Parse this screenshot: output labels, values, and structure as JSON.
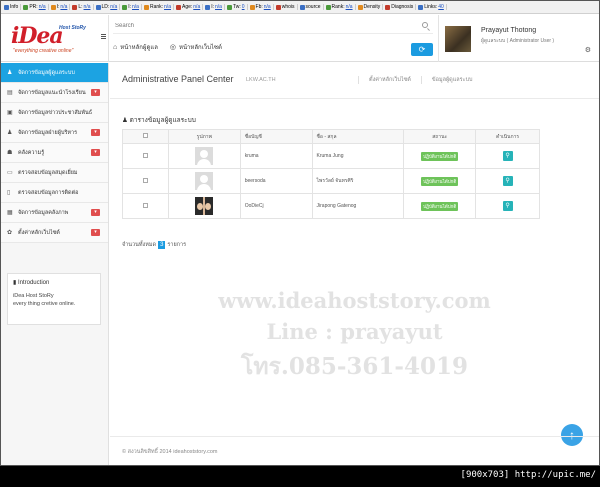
{
  "seo_bar": [
    {
      "label": "Info",
      "value": ""
    },
    {
      "label": "PR:",
      "value": "n/a"
    },
    {
      "label": "I:",
      "value": "n/a"
    },
    {
      "label": "L:",
      "value": "n/a"
    },
    {
      "label": "LD:",
      "value": "n/a"
    },
    {
      "label": "I:",
      "value": "n/a"
    },
    {
      "label": "Rank:",
      "value": "n/a"
    },
    {
      "label": "Age:",
      "value": "n/a"
    },
    {
      "label": "I:",
      "value": "n/a"
    },
    {
      "label": "Tw:",
      "value": "0"
    },
    {
      "label": "Fb:",
      "value": "n/a"
    },
    {
      "label": "whois",
      "value": ""
    },
    {
      "label": "source",
      "value": ""
    },
    {
      "label": "Rank:",
      "value": "n/a"
    },
    {
      "label": "Density",
      "value": ""
    },
    {
      "label": "Diagnosis",
      "value": ""
    },
    {
      "label": "Links:",
      "value": "40"
    }
  ],
  "logo": {
    "text": "iDea",
    "small": "Host StoRy",
    "tagline": "\"everything creative online\""
  },
  "search": {
    "placeholder": "Search"
  },
  "topnav": [
    {
      "label": "หน้าหลักผู้ดูแล",
      "icon": "⌂"
    },
    {
      "label": "หน้าหลักเว็บไซต์",
      "icon": "◎"
    }
  ],
  "user": {
    "name": "Prayayut Thotong",
    "role": "ผู้ดูแลระบบ ( Administrator User )"
  },
  "sidebar": {
    "items": [
      {
        "label": "จัดการข้อมูลผู้ดูแลระบบ",
        "icon": "♟",
        "active": true,
        "caret": false
      },
      {
        "label": "จัดการข้อมูลแนะนำโรงเรียน",
        "icon": "▤",
        "active": false,
        "caret": true
      },
      {
        "label": "จัดการข้อมูลข่าวประชาสัมพันธ์",
        "icon": "▣",
        "active": false,
        "caret": false
      },
      {
        "label": "จัดการข้อมูลฝ่ายผู้บริหาร",
        "icon": "♟",
        "active": false,
        "caret": true
      },
      {
        "label": "คลังความรู้",
        "icon": "☗",
        "active": false,
        "caret": true
      },
      {
        "label": "ตรวจสอบข้อมูลสมุดเยี่ยม",
        "icon": "▭",
        "active": false,
        "caret": false
      },
      {
        "label": "ตรวจสอบข้อมูลการติดต่อ",
        "icon": "▯",
        "active": false,
        "caret": false
      },
      {
        "label": "จัดการข้อมูลคลังภาพ",
        "icon": "▦",
        "active": false,
        "caret": true
      },
      {
        "label": "ตั้งค่าหลักเว็บไซต์",
        "icon": "✿",
        "active": false,
        "caret": true
      }
    ],
    "intro_title": "Introduction",
    "intro_lines": [
      "iDea Host StoRy",
      "every thing cretive online."
    ]
  },
  "main": {
    "title": "Administrative Panel Center",
    "subtitle": "LKW.AC.TH",
    "crumbs": [
      "ตั้งค่าหลักเว็บไซต์",
      "ข้อมูลผู้ดูแลระบบ"
    ],
    "section_title": "ตารางข้อมูลผู้ดูแลระบบ",
    "columns": [
      "",
      "รูปภาพ",
      "ชื่อบัญชี",
      "ชื่อ - สกุล",
      "สถานะ",
      "ดำเนินการ"
    ],
    "rows": [
      {
        "account": "kruma",
        "fullname": "Kruma Jung",
        "status": "ปฏิบัติงานได้ปกติ",
        "photo": "generic"
      },
      {
        "account": "beersoda",
        "fullname": "ไพรวัลย์ จันทรศิริ",
        "status": "ปฏิบัติงานได้ปกติ",
        "photo": "generic"
      },
      {
        "account": "OoDieCj",
        "fullname": "Jirapong Gatenog",
        "status": "ปฏิบัติงานได้ปกติ",
        "photo": "photo"
      }
    ],
    "count_prefix": "จำนวนทั้งหมด",
    "count_value": "3",
    "count_suffix": "รายการ",
    "watermark": [
      "www.ideahoststory.com",
      "Line : prayayut",
      "โทร.085-361-4019"
    ],
    "copyright": "© สงวนลิขสิทธิ์ 2014 ideahoststory.com"
  },
  "stamp": "[900x703] http://upic.me/",
  "colors": {
    "accent": "#1ca3e2",
    "status": "#6ec35a",
    "action": "#26b3b8",
    "caret": "#e04e4e",
    "logo": "#d11f2a"
  }
}
